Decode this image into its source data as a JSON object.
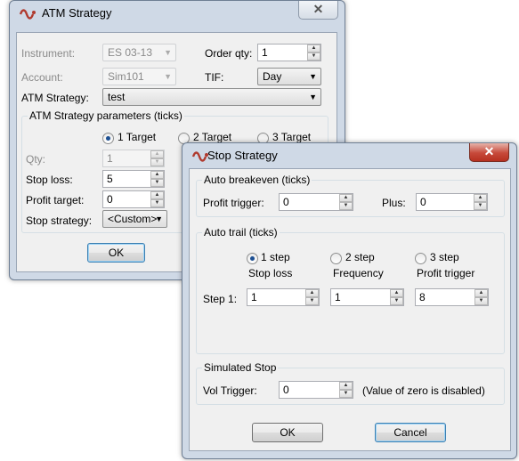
{
  "atm": {
    "title": "ATM Strategy",
    "close": "✕",
    "instrument_label": "Instrument:",
    "instrument_value": "ES 03-13",
    "account_label": "Account:",
    "account_value": "Sim101",
    "order_qty_label": "Order qty:",
    "order_qty_value": "1",
    "tif_label": "TIF:",
    "tif_value": "Day",
    "strategy_label": "ATM Strategy:",
    "strategy_value": "test",
    "params_title": "ATM Strategy parameters (ticks)",
    "targets": [
      "1 Target",
      "2 Target",
      "3 Target"
    ],
    "selected_target": 0,
    "qty_label": "Qty:",
    "qty_value": "1",
    "stop_loss_label": "Stop loss:",
    "stop_loss_value": "5",
    "profit_target_label": "Profit target:",
    "profit_target_value": "0",
    "stop_strategy_label": "Stop strategy:",
    "stop_strategy_value": "<Custom>",
    "ok_label": "OK"
  },
  "stop": {
    "title": "Stop Strategy",
    "close": "✕",
    "auto_breakeven_title": "Auto breakeven (ticks)",
    "profit_trigger_label": "Profit trigger:",
    "profit_trigger_value": "0",
    "plus_label": "Plus:",
    "plus_value": "0",
    "auto_trail_title": "Auto trail (ticks)",
    "steps": [
      "1 step",
      "2 step",
      "3 step"
    ],
    "selected_step": 0,
    "col_headers": [
      "Stop loss",
      "Frequency",
      "Profit trigger"
    ],
    "step1_label": "Step 1:",
    "step1_values": [
      "1",
      "1",
      "8"
    ],
    "simulated_stop_title": "Simulated Stop",
    "vol_trigger_label": "Vol Trigger:",
    "vol_trigger_value": "0",
    "vol_trigger_note": "(Value of zero is disabled)",
    "ok_label": "OK",
    "cancel_label": "Cancel"
  },
  "colors": {
    "title_frame": "#cfd9e6",
    "client_bg": "#f0f0f0",
    "radio_dot": "#1c4f92",
    "close_red": "#c7493a"
  }
}
